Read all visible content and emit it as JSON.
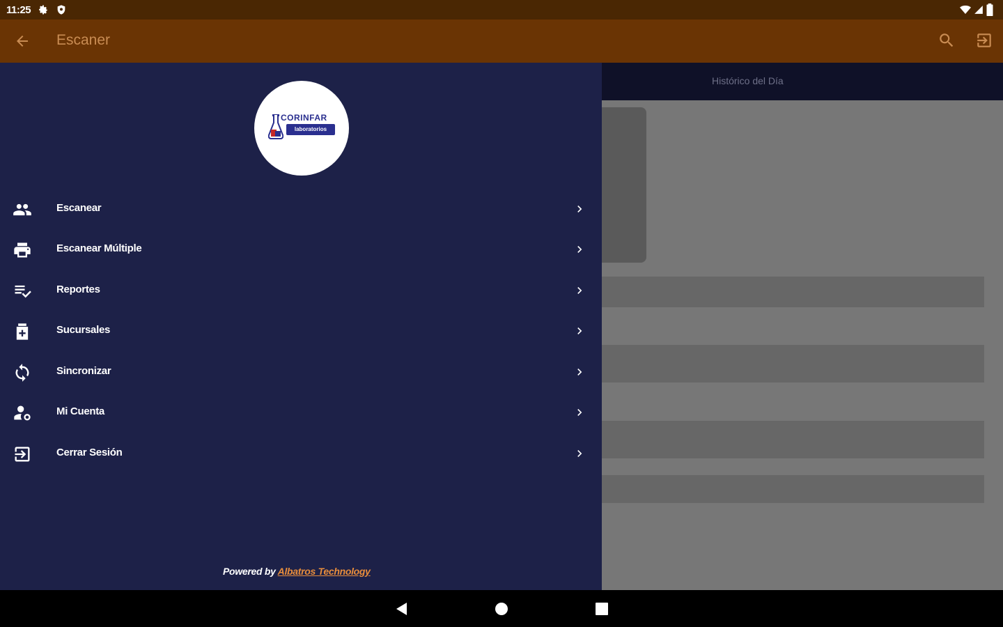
{
  "status_bar": {
    "time": "11:25",
    "icons_left": [
      "settings-icon",
      "shield-icon"
    ],
    "icons_right": [
      "wifi-icon",
      "signal-icon",
      "battery-icon"
    ]
  },
  "app_bar": {
    "title": "Escaner",
    "actions": [
      "search-icon",
      "logout-icon"
    ],
    "background": "#6a3404"
  },
  "background_view": {
    "tab_label": "Histórico del Día"
  },
  "drawer": {
    "background": "#1d2148",
    "logo": {
      "top_text": "CORINFAR",
      "bottom_text": "laboratorios"
    },
    "items": [
      {
        "label": "Escanear",
        "icon": "people-icon"
      },
      {
        "label": "Escanear Múltiple",
        "icon": "printer-icon"
      },
      {
        "label": "Reportes",
        "icon": "list-check-icon"
      },
      {
        "label": "Sucursales",
        "icon": "store-icon"
      },
      {
        "label": "Sincronizar",
        "icon": "sync-icon"
      },
      {
        "label": "Mi Cuenta",
        "icon": "account-icon"
      },
      {
        "label": "Cerrar Sesión",
        "icon": "logout-icon"
      }
    ],
    "footer": {
      "prefix": "Powered by ",
      "link": "Albatros Technology",
      "link_color": "#e88d3c"
    }
  },
  "nav_bar": {
    "buttons": [
      "back-triangle-icon",
      "home-circle-icon",
      "recents-square-icon"
    ]
  }
}
